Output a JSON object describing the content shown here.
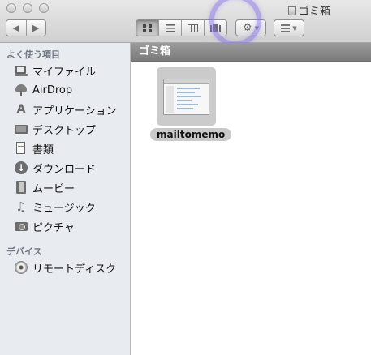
{
  "window": {
    "title": "ゴミ箱"
  },
  "toolbar": {
    "nav_back": "◀",
    "nav_forward": "▶",
    "views": [
      "icon",
      "list",
      "column",
      "coverflow"
    ],
    "active_view": "icon"
  },
  "sidebar": {
    "favorites_header": "よく使う項目",
    "favorites": [
      {
        "label": "マイファイル",
        "icon": "all-my-files-icon"
      },
      {
        "label": "AirDrop",
        "icon": "airdrop-icon"
      },
      {
        "label": "アプリケーション",
        "icon": "applications-icon"
      },
      {
        "label": "デスクトップ",
        "icon": "desktop-icon"
      },
      {
        "label": "書類",
        "icon": "documents-icon"
      },
      {
        "label": "ダウンロード",
        "icon": "downloads-icon"
      },
      {
        "label": "ムービー",
        "icon": "movies-icon"
      },
      {
        "label": "ミュージック",
        "icon": "music-icon"
      },
      {
        "label": "ピクチャ",
        "icon": "pictures-icon"
      }
    ],
    "devices_header": "デバイス",
    "devices": [
      {
        "label": "リモートディスク",
        "icon": "remote-disc-icon"
      }
    ]
  },
  "main": {
    "path_title": "ゴミ箱",
    "files": [
      {
        "name": "mailtomemo",
        "selected": true
      }
    ]
  }
}
